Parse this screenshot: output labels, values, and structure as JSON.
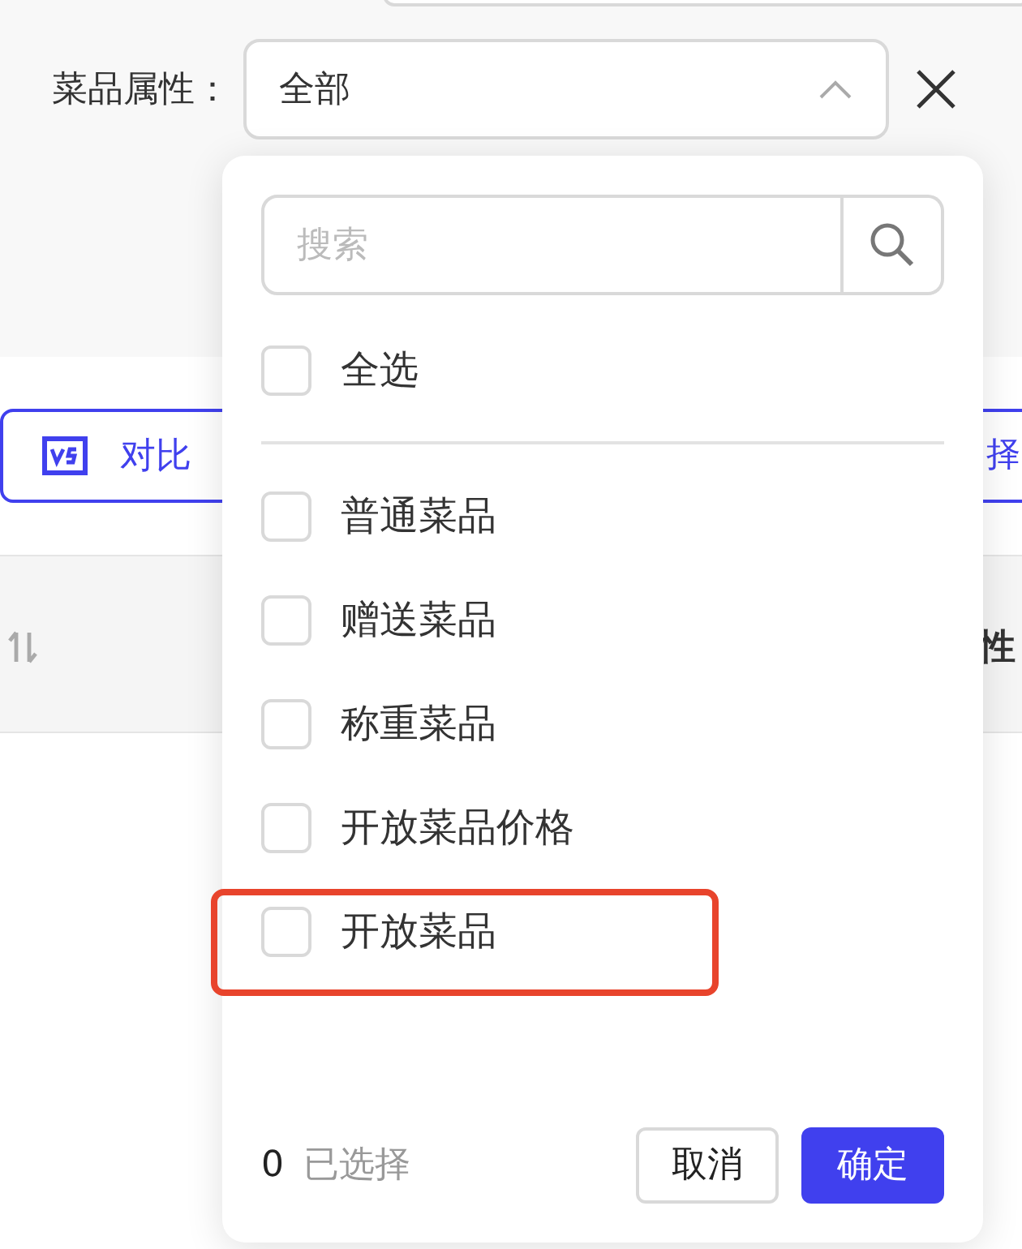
{
  "filter": {
    "label": "菜品属性：",
    "value": "全部",
    "expanded": true
  },
  "toolbar": {
    "compare_button": "对比",
    "button_2": "择"
  },
  "table": {
    "header_cell": "性"
  },
  "dropdown": {
    "search": {
      "placeholder": "搜索"
    },
    "select_all": {
      "label": "全选",
      "checked": false
    },
    "options": [
      {
        "label": "普通菜品",
        "checked": false,
        "highlighted": false
      },
      {
        "label": "赠送菜品",
        "checked": false,
        "highlighted": false
      },
      {
        "label": "称重菜品",
        "checked": false,
        "highlighted": false
      },
      {
        "label": "开放菜品价格",
        "checked": false,
        "highlighted": false
      },
      {
        "label": "开放菜品",
        "checked": false,
        "highlighted": true
      }
    ],
    "footer": {
      "count": "0",
      "count_label": "已选择",
      "cancel": "取消",
      "confirm": "确定"
    }
  }
}
